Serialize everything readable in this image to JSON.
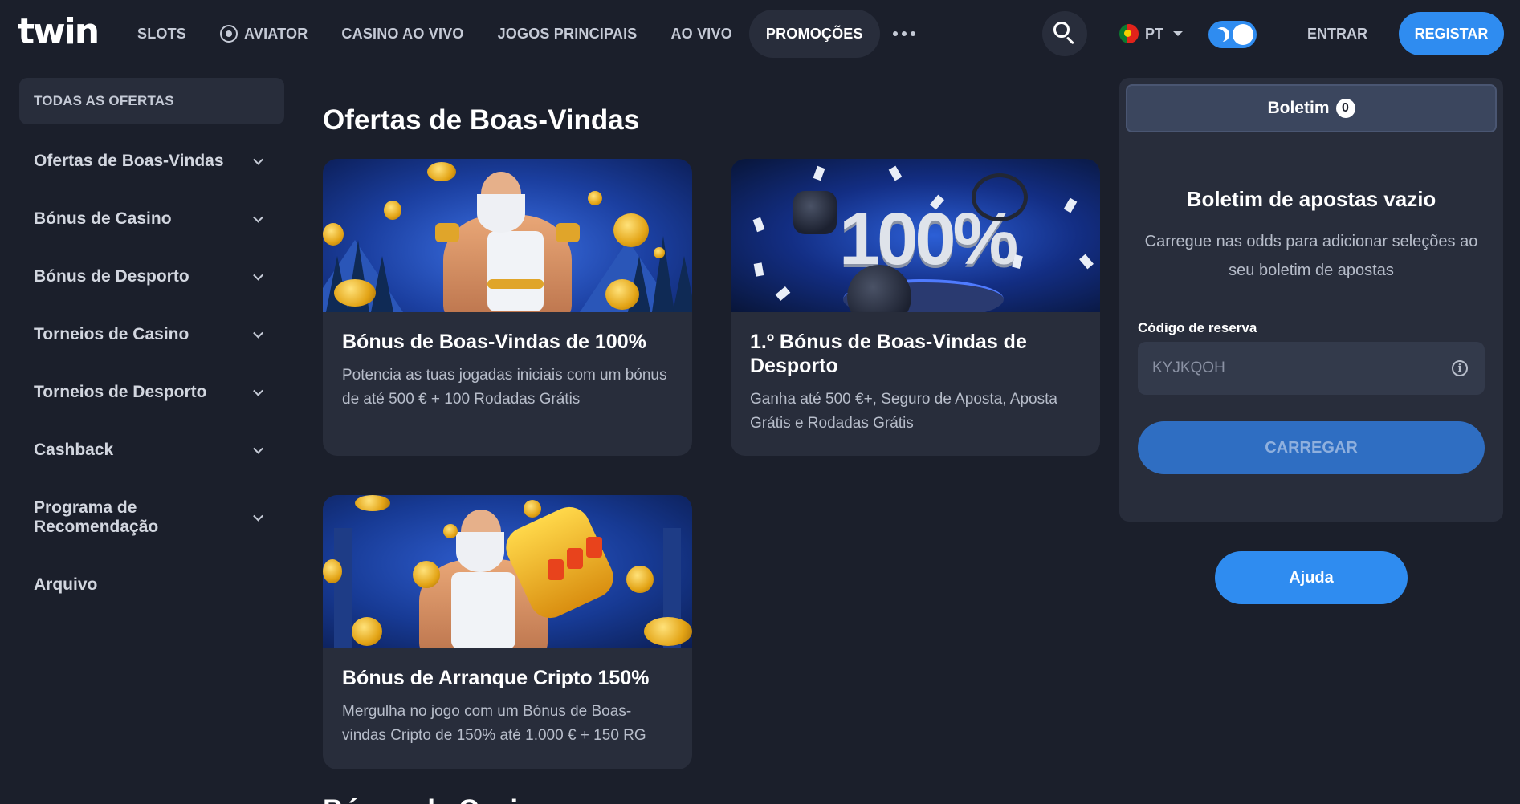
{
  "header": {
    "logo": "twin",
    "nav": [
      {
        "label": "SLOTS"
      },
      {
        "label": "AVIATOR",
        "icon": "aviator-icon"
      },
      {
        "label": "CASINO AO VIVO"
      },
      {
        "label": "JOGOS PRINCIPAIS"
      },
      {
        "label": "AO VIVO"
      },
      {
        "label": "PROMOÇÕES",
        "active": true
      }
    ],
    "language": "PT",
    "login_label": "ENTRAR",
    "register_label": "REGISTAR",
    "theme": "dark"
  },
  "sidebar": {
    "all_offers_label": "TODAS AS OFERTAS",
    "items": [
      {
        "label": "Ofertas de Boas-Vindas",
        "expandable": true
      },
      {
        "label": "Bónus de Casino",
        "expandable": true
      },
      {
        "label": "Bónus de Desporto",
        "expandable": true
      },
      {
        "label": "Torneios de Casino",
        "expandable": true
      },
      {
        "label": "Torneios de Desporto",
        "expandable": true
      },
      {
        "label": "Cashback",
        "expandable": true
      },
      {
        "label": "Programa de Recomendação",
        "expandable": true
      },
      {
        "label": "Arquivo",
        "expandable": false
      }
    ]
  },
  "main": {
    "section_title": "Ofertas de Boas-Vindas",
    "cards": [
      {
        "title": "Bónus de Boas-Vindas de 100%",
        "description": "Potencia as tuas jogadas iniciais com um bónus de até 500 € + 100 Rodadas Grátis"
      },
      {
        "title": "1.º Bónus de Boas-Vindas de Desporto",
        "description": "Ganha até 500 €+, Seguro de Aposta, Aposta Grátis e Rodadas Grátis",
        "image_text": "100%"
      },
      {
        "title": "Bónus de Arranque Cripto 150%",
        "description": "Mergulha no jogo com um Bónus de Boas-vindas Cripto de 150% até 1.000 € + 150 RG"
      }
    ],
    "next_section_title": "Bónus de Casino"
  },
  "betslip": {
    "tab_label": "Boletim",
    "count": "0",
    "empty_title": "Boletim de apostas vazio",
    "empty_description": "Carregue nas odds para adicionar seleções ao seu boletim de apostas",
    "reserve_label": "Código de reserva",
    "reserve_placeholder": "KYJKQOH",
    "load_label": "CARREGAR",
    "help_label": "Ajuda"
  },
  "colors": {
    "background": "#1b1f2b",
    "panel": "#282d3b",
    "accent": "#2f8cf0"
  }
}
